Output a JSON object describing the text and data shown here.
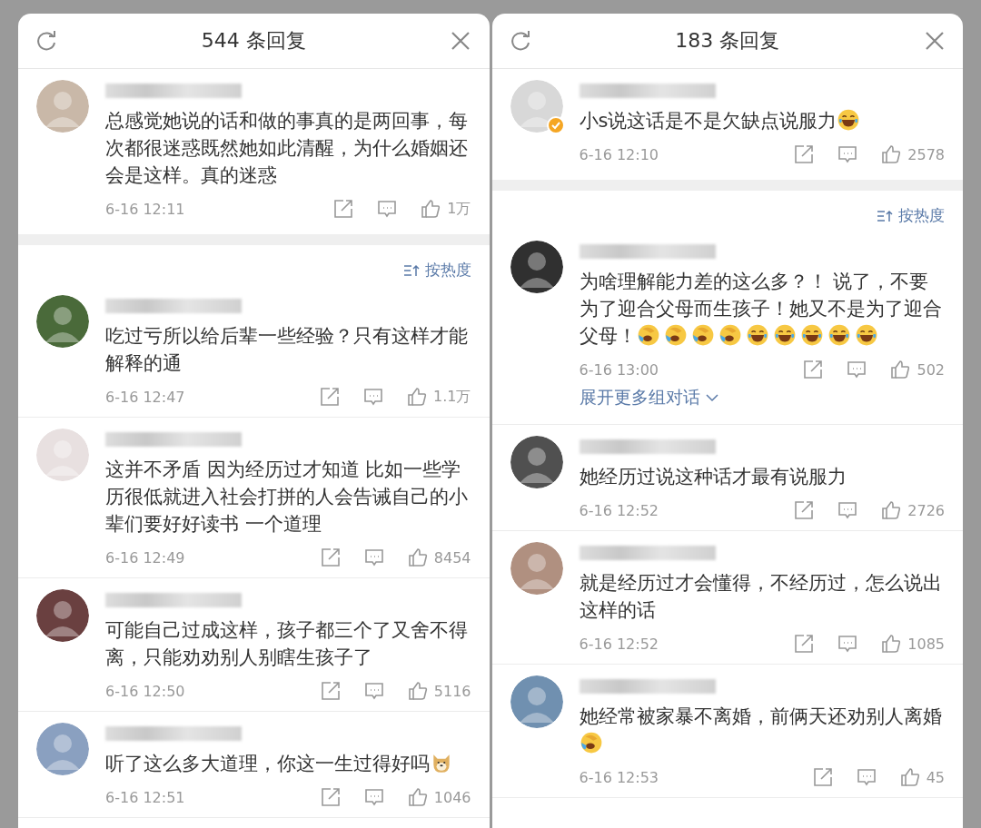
{
  "panels": [
    {
      "title": "544 条回复",
      "root": {
        "text": "总感觉她说的话和做的事真的是两回事，每次都很迷惑既然她如此清醒，为什么婚姻还会是这样。真的迷惑",
        "time": "6-16 12:11",
        "likes": "1万",
        "verified": false
      },
      "sort_label": "按热度",
      "replies": [
        {
          "text": "吃过亏所以给后辈一些经验？只有这样才能解释的通",
          "time": "6-16 12:47",
          "likes": "1.1万",
          "verified": false
        },
        {
          "text": "这并不矛盾 因为经历过才知道 比如一些学历很低就进入社会打拼的人会告诫自己的小辈们要好好读书 一个道理",
          "time": "6-16 12:49",
          "likes": "8454",
          "verified": false
        },
        {
          "text": "可能自己过成这样，孩子都三个了又舍不得离，只能劝劝别人别瞎生孩子了",
          "time": "6-16 12:50",
          "likes": "5116",
          "verified": false
        },
        {
          "text": "听了这么多大道理，你这一生过得好吗",
          "emojis": [
            {
              "kind": "doge"
            }
          ],
          "time": "6-16 12:51",
          "likes": "1046",
          "verified": false
        }
      ]
    },
    {
      "title": "183 条回复",
      "root": {
        "text": "小s说这话是不是欠缺点说服力",
        "emojis": [
          {
            "kind": "laugh"
          }
        ],
        "time": "6-16 12:10",
        "likes": "2578",
        "verified": true
      },
      "sort_label": "按热度",
      "replies": [
        {
          "text": "为啥理解能力差的这么多？！ 说了，不要为了迎合父母而生孩子！她又不是为了迎合父母！",
          "emojis": [
            {
              "kind": "cry"
            },
            {
              "kind": "cry"
            },
            {
              "kind": "cry"
            },
            {
              "kind": "cry"
            },
            {
              "kind": "laugh"
            },
            {
              "kind": "laugh"
            },
            {
              "kind": "laugh"
            },
            {
              "kind": "laugh"
            },
            {
              "kind": "laugh"
            }
          ],
          "time": "6-16 13:00",
          "likes": "502",
          "verified": false,
          "expand_link": "展开更多组对话"
        },
        {
          "text": "她经历过说这种话才最有说服力",
          "time": "6-16 12:52",
          "likes": "2726",
          "verified": false
        },
        {
          "text": "就是经历过才会懂得，不经历过，怎么说出这样的话",
          "time": "6-16 12:52",
          "likes": "1085",
          "verified": false
        },
        {
          "text": "她经常被家暴不离婚，前俩天还劝别人离婚",
          "emojis": [
            {
              "kind": "cry"
            }
          ],
          "time": "6-16 12:53",
          "likes": "45",
          "verified": false
        }
      ]
    }
  ]
}
